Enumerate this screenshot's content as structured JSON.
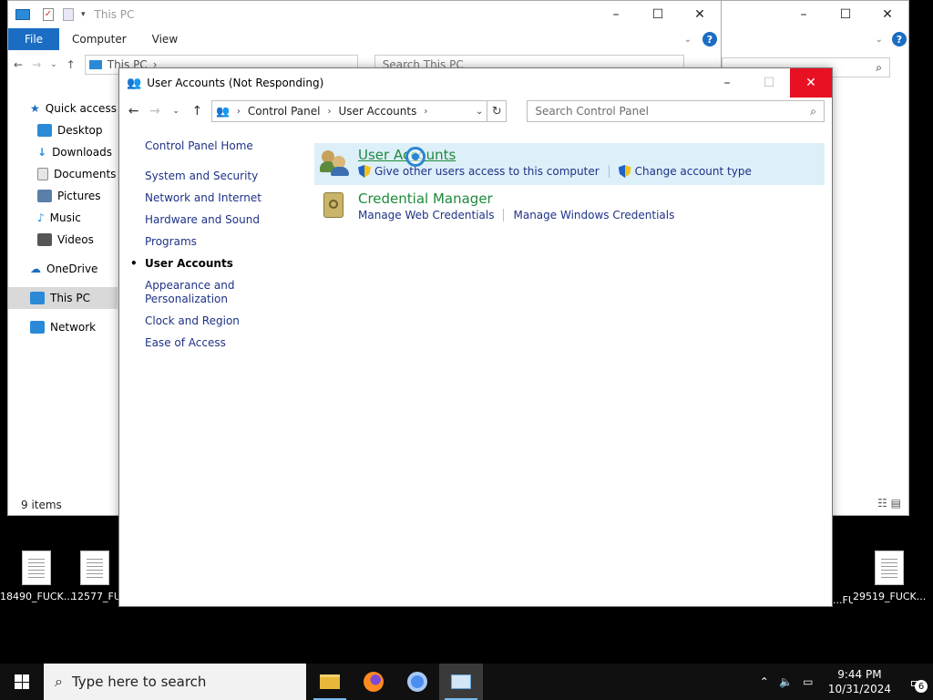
{
  "explorer": {
    "title": "This PC",
    "ribbon_tabs": [
      "File",
      "Computer",
      "View"
    ],
    "address": "This PC",
    "search_placeholder": "Search This PC",
    "nav": [
      {
        "label": "Quick access",
        "icon": "star-icon",
        "color": "#1a6dc2"
      },
      {
        "label": "Desktop",
        "icon": "desktop-folder-icon",
        "color": "#2b8ad8"
      },
      {
        "label": "Downloads",
        "icon": "download-arrow-icon",
        "color": "#2b8ad8"
      },
      {
        "label": "Documents",
        "icon": "documents-icon",
        "color": "#8c8c8c"
      },
      {
        "label": "Pictures",
        "icon": "pictures-icon",
        "color": "#5a7fa8"
      },
      {
        "label": "Music",
        "icon": "music-note-icon",
        "color": "#2b8ad8"
      },
      {
        "label": "Videos",
        "icon": "videos-icon",
        "color": "#555555"
      },
      {
        "label": "OneDrive",
        "icon": "cloud-icon",
        "color": "#1a6dc2"
      },
      {
        "label": "This PC",
        "icon": "computer-icon",
        "color": "#2b8ad8"
      },
      {
        "label": "Network",
        "icon": "network-icon",
        "color": "#2b8ad8"
      }
    ],
    "status": "9 items"
  },
  "control_panel": {
    "title": "User Accounts (Not Responding)",
    "breadcrumb": [
      "Control Panel",
      "User Accounts"
    ],
    "search_placeholder": "Search Control Panel",
    "left_links": [
      "Control Panel Home",
      "System and Security",
      "Network and Internet",
      "Hardware and Sound",
      "Programs",
      "User Accounts",
      "Appearance and Personalization",
      "Clock and Region",
      "Ease of Access"
    ],
    "current": "User Accounts",
    "categories": [
      {
        "title": "User Accounts",
        "links": [
          "Give other users access to this computer",
          "Change account type"
        ]
      },
      {
        "title": "Credential Manager",
        "links": [
          "Manage Web Credentials",
          "Manage Windows Credentials"
        ]
      }
    ]
  },
  "desktop": {
    "icons": [
      "18490_FUCK...",
      "12577_FU",
      "...FUCK...",
      "29519_FUCK..."
    ]
  },
  "taskbar": {
    "search_placeholder": "Type here to search",
    "time": "9:44 PM",
    "date": "10/31/2024",
    "notification_count": "6"
  }
}
